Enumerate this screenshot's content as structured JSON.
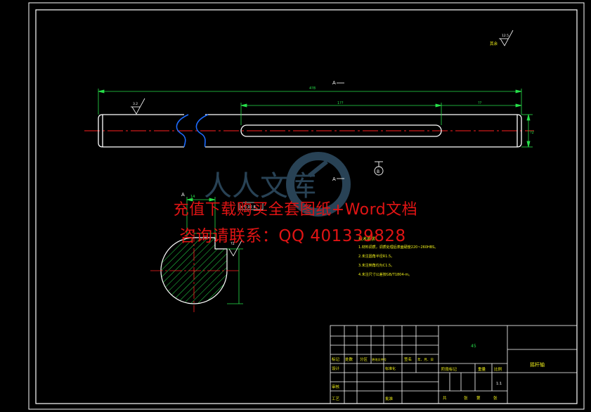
{
  "colors": {
    "background": "#000000",
    "frame": "#ffffff",
    "part": "#ffffff",
    "dimension": "#27e04a",
    "centerline": "#ff2020",
    "hatch": "#27e04a",
    "notes": "#f2f21a",
    "watermark_text": "#e01414",
    "watermark_logo": "#3a5e7a"
  },
  "dimensions": {
    "overall_length": "4?8",
    "keyway_length": "1??",
    "right_segment": "??",
    "diameter_side": "?2",
    "section_width": "14",
    "section_depth": "?2",
    "roughness_general": "12.5",
    "roughness_surface": "3.2",
    "roughness_keyway": "3.2"
  },
  "labels": {
    "section_letter_top": "A",
    "section_letter_left": "A",
    "section_letter_right": "A",
    "section_marker": "B",
    "roughness_note": "其余",
    "tolerance_frame": "≡ 0.02 B"
  },
  "notes": {
    "title": "技术要求",
    "items": [
      "1.材料调质，调质处理后表面硬度220~260HBS。",
      "2.未注圆角半径R1.5。",
      "3.未注倒角均为C1.5。",
      "4.未注尺寸公差按GB/T1804-m。"
    ]
  },
  "title_block": {
    "material": "45",
    "part_name": "摇杆轴",
    "scale": "1:1",
    "headers": [
      "标记",
      "处数",
      "分区",
      "更改文件号",
      "签名",
      "年、月、日"
    ],
    "row_design": [
      "设计",
      "标准化"
    ],
    "row_review": [
      "审核"
    ],
    "row_process": [
      "工艺",
      "批准"
    ],
    "stage_headers": [
      "阶段标记",
      "重量",
      "比例"
    ],
    "sheet_labels": [
      "共",
      "张",
      "第",
      "张"
    ]
  },
  "watermark": {
    "line1": "充值下载购买全套图纸+Word文档",
    "line2": "咨询请联系：QQ 401339828",
    "logo_text": "人人文库"
  }
}
